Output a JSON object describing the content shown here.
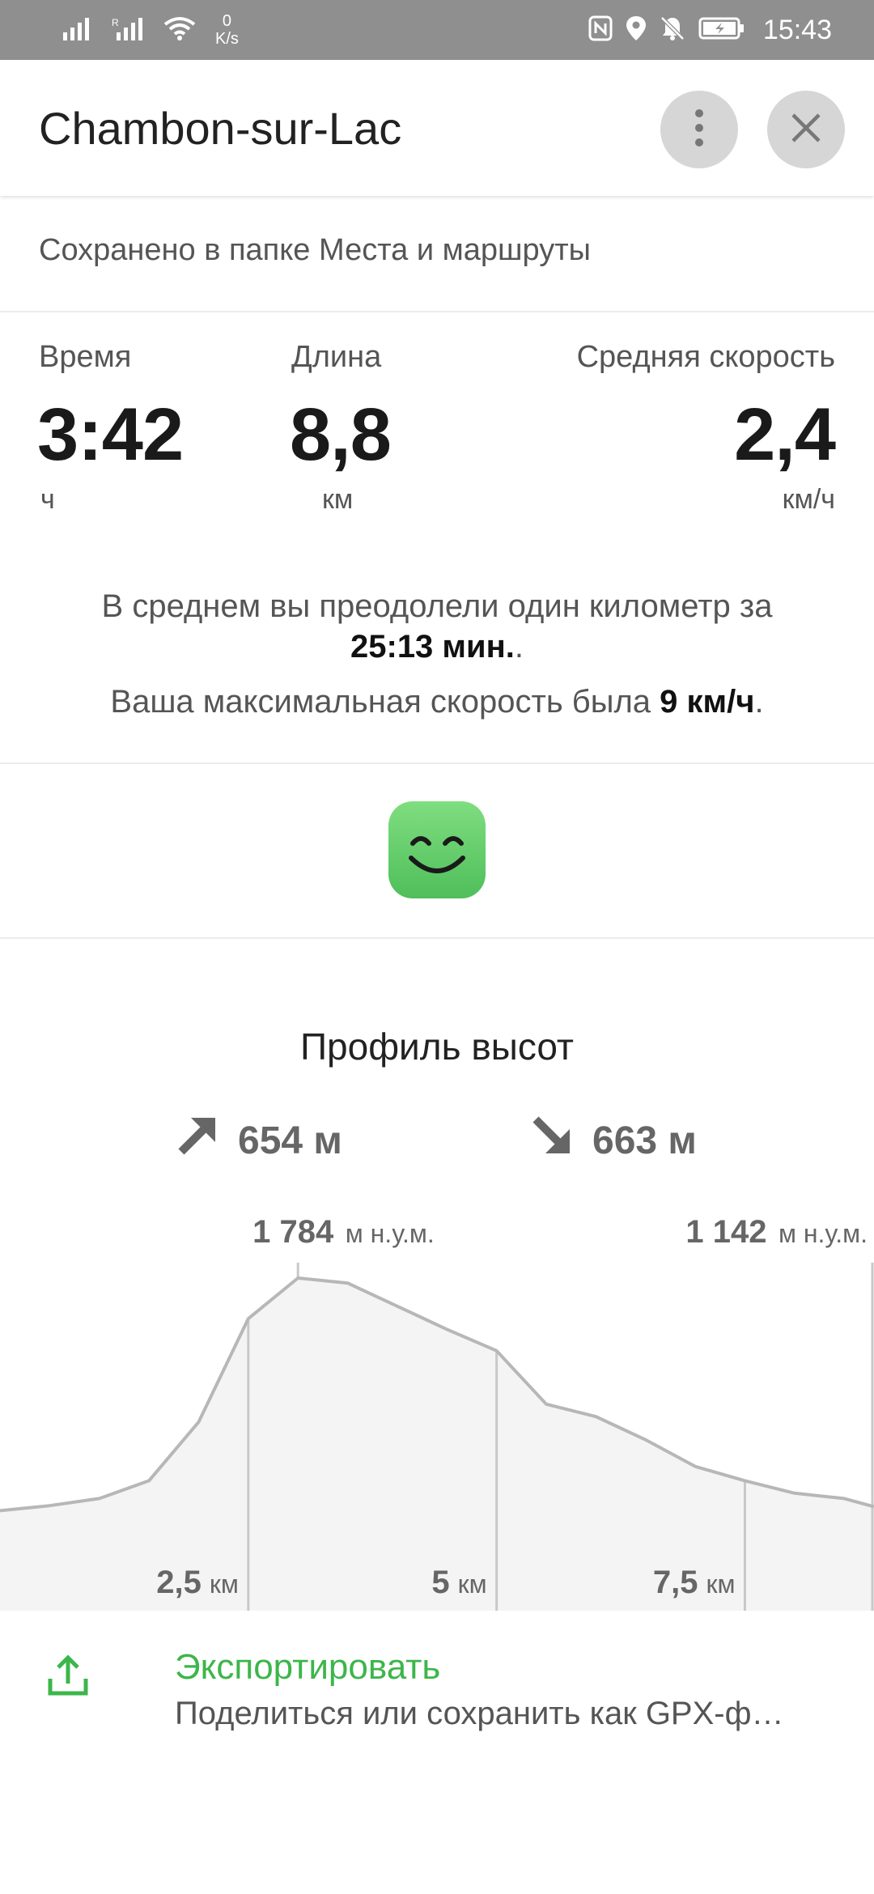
{
  "status_bar": {
    "net_speed_value": "0",
    "net_speed_unit": "K/s",
    "time": "15:43",
    "icons": [
      "signal-icon",
      "signal-roaming-icon",
      "wifi-icon",
      "nfc-icon",
      "location-icon",
      "bell-off-icon",
      "battery-charging-icon"
    ]
  },
  "header": {
    "title": "Chambon-sur-Lac",
    "more_icon": "more-vert-icon",
    "close_icon": "close-icon"
  },
  "saved_text": "Сохранено в папке Места и маршруты",
  "stats": {
    "time": {
      "label": "Время",
      "value": "3:42",
      "unit": "ч"
    },
    "length": {
      "label": "Длина",
      "value": "8,8",
      "unit": "км"
    },
    "speed": {
      "label": "Средняя скорость",
      "value": "2,4",
      "unit": "км/ч"
    }
  },
  "pace": {
    "text": "В среднем вы преодолели один километр за",
    "value": "25:13 мин.",
    "suffix": "."
  },
  "max_speed": {
    "text": "Ваша максимальная скорость была",
    "value": "9 км/ч",
    "suffix": "."
  },
  "mood_icon": "smiling-face-icon",
  "elevation": {
    "title": "Профиль высот",
    "ascent": "654 м",
    "descent": "663 м",
    "max": {
      "value": "1 784",
      "unit": "м н.у.м."
    },
    "end": {
      "value": "1 142",
      "unit": "м н.у.м."
    },
    "x_ticks": [
      {
        "value": "2,5",
        "unit": "км"
      },
      {
        "value": "5",
        "unit": "км"
      },
      {
        "value": "7,5",
        "unit": "км"
      }
    ],
    "profile_km": [
      0,
      0.5,
      1.0,
      1.5,
      2.0,
      2.5,
      3.0,
      3.5,
      4.0,
      4.5,
      5.0,
      5.5,
      6.0,
      6.5,
      7.0,
      7.5,
      8.0,
      8.5,
      8.8
    ],
    "profile_m": [
      1131,
      1145,
      1165,
      1215,
      1380,
      1670,
      1784,
      1770,
      1705,
      1640,
      1580,
      1430,
      1395,
      1330,
      1255,
      1215,
      1180,
      1165,
      1142
    ],
    "colors": {
      "line": "#b7b7b7",
      "fill": "#f4f4f4",
      "guide": "#c8c8c8"
    }
  },
  "export": {
    "icon": "share-upload-icon",
    "title": "Экспортировать",
    "subtitle": "Поделиться или сохранить как GPX-ф…",
    "accent": "#3cb64a"
  }
}
